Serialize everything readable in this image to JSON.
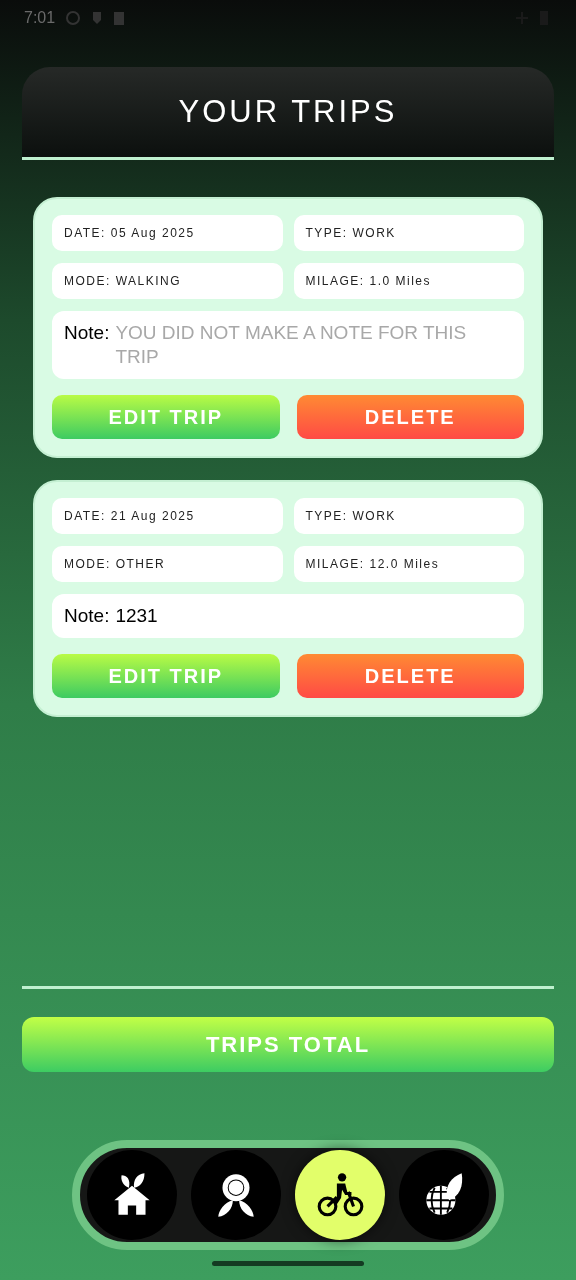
{
  "status_bar": {
    "time": "7:01"
  },
  "header": {
    "title": "YOUR TRIPS"
  },
  "trips": [
    {
      "date": "DATE: 05 Aug 2025",
      "type": "TYPE: WORK",
      "mode": "MODE: WALKING",
      "milage": "MILAGE: 1.0 Miles",
      "note_label": "Note:",
      "note_placeholder": "YOU DID NOT MAKE A NOTE FOR THIS TRIP",
      "edit": "EDIT TRIP",
      "delete": "DELETE"
    },
    {
      "date": "DATE: 21 Aug 2025",
      "type": "TYPE: WORK",
      "mode": "MODE: OTHER",
      "milage": "MILAGE: 12.0 Miles",
      "note_label": "Note:",
      "note": "1231",
      "edit": "EDIT TRIP",
      "delete": "DELETE"
    }
  ],
  "total_button": "TRIPS TOTAL",
  "nav": [
    {
      "kind": "home",
      "selected": false
    },
    {
      "kind": "award",
      "selected": false
    },
    {
      "kind": "bike",
      "selected": true
    },
    {
      "kind": "globe",
      "selected": false
    }
  ]
}
